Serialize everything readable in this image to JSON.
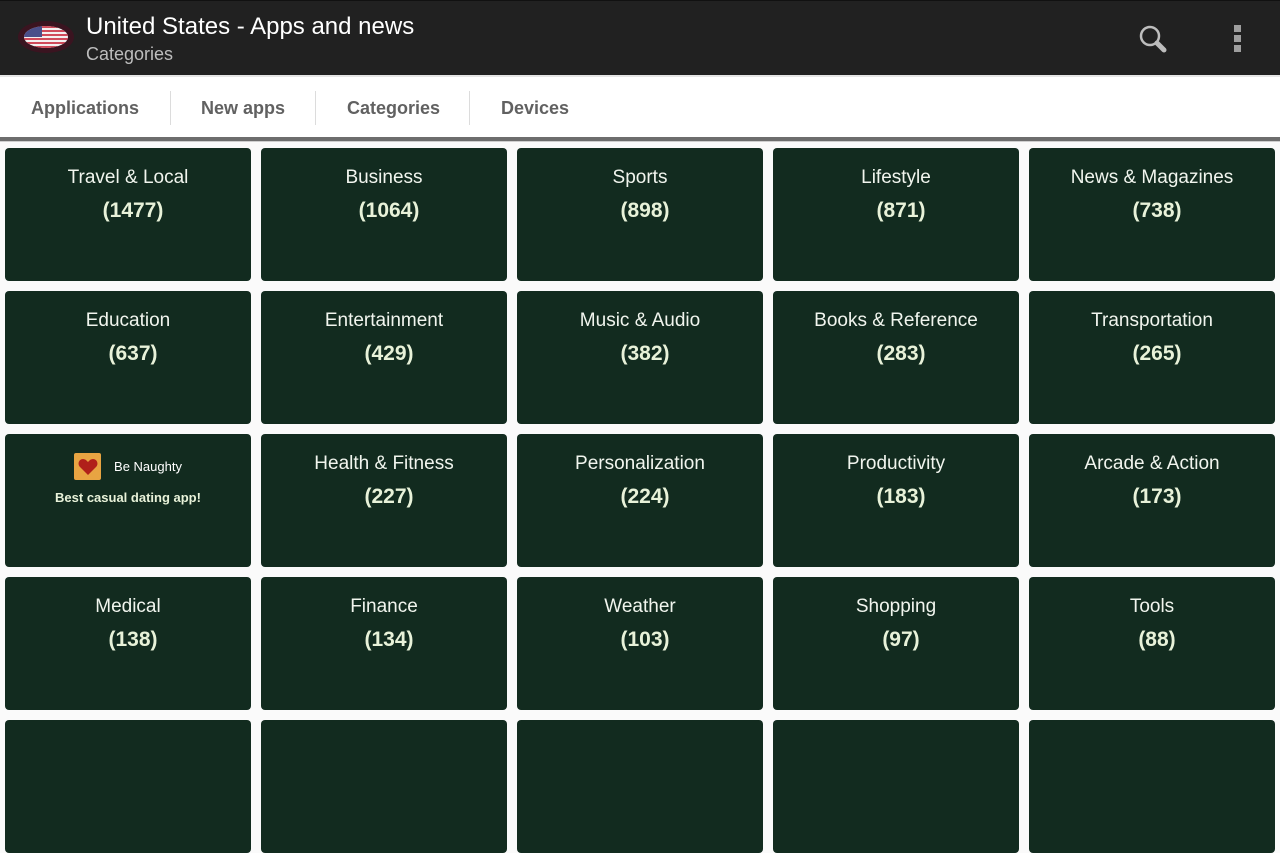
{
  "actionbar": {
    "title": "United States - Apps and news",
    "subtitle": "Categories",
    "flag_icon": "us-flag-icon",
    "search_icon": "search-icon",
    "overflow_icon": "more-vertical-icon"
  },
  "tabs": [
    {
      "label": "Applications"
    },
    {
      "label": "New apps"
    },
    {
      "label": "Categories"
    },
    {
      "label": "Devices"
    }
  ],
  "colors": {
    "actionbar_bg": "#212121",
    "tile_bg": "#122b1f",
    "tile_text": "#f1f5ee",
    "tab_text": "#616161"
  },
  "ad": {
    "name": "Be Naughty",
    "tagline": "Best casual dating app!",
    "icon": "heart-icon"
  },
  "categories": [
    {
      "name": "Travel & Local",
      "count": "(1477)"
    },
    {
      "name": "Business",
      "count": "(1064)"
    },
    {
      "name": "Sports",
      "count": "(898)"
    },
    {
      "name": "Lifestyle",
      "count": "(871)"
    },
    {
      "name": "News & Magazines",
      "count": "(738)"
    },
    {
      "name": "Education",
      "count": "(637)"
    },
    {
      "name": "Entertainment",
      "count": "(429)"
    },
    {
      "name": "Music & Audio",
      "count": "(382)"
    },
    {
      "name": "Books & Reference",
      "count": "(283)"
    },
    {
      "name": "Transportation",
      "count": "(265)"
    },
    {
      "name": "Health & Fitness",
      "count": "(227)"
    },
    {
      "name": "Personalization",
      "count": "(224)"
    },
    {
      "name": "Productivity",
      "count": "(183)"
    },
    {
      "name": "Arcade & Action",
      "count": "(173)"
    },
    {
      "name": "Medical",
      "count": "(138)"
    },
    {
      "name": "Finance",
      "count": "(134)"
    },
    {
      "name": "Weather",
      "count": "(103)"
    },
    {
      "name": "Shopping",
      "count": "(97)"
    },
    {
      "name": "Tools",
      "count": "(88)"
    }
  ]
}
